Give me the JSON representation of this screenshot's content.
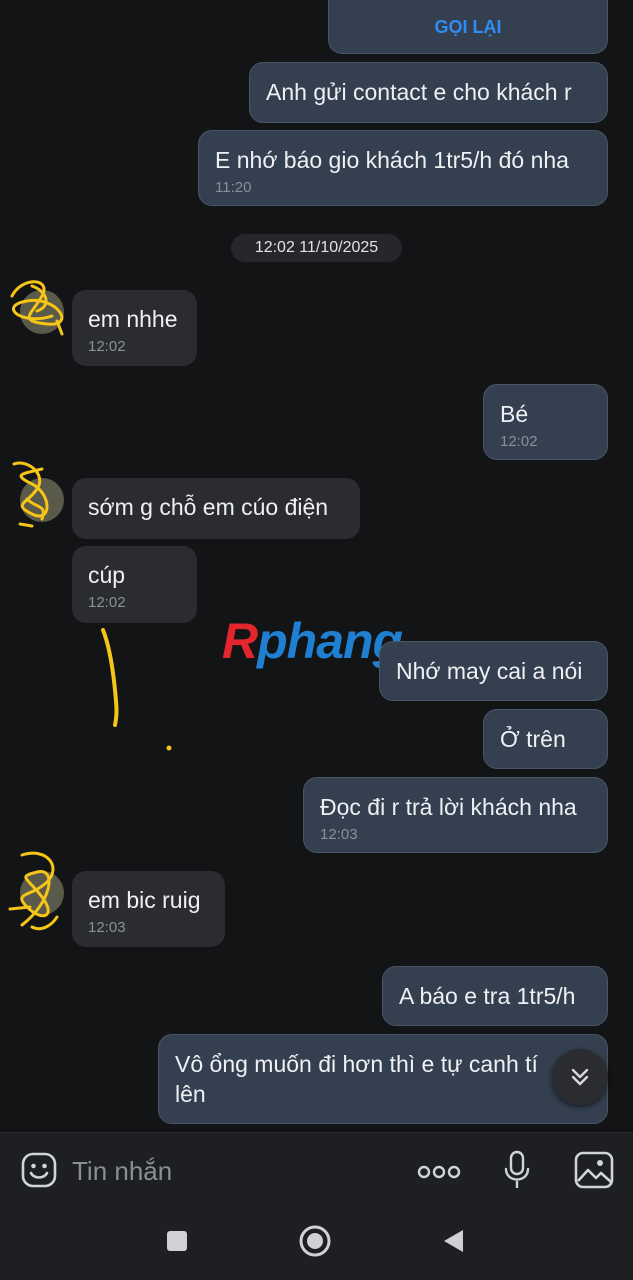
{
  "call_card": {
    "action_label": "GỌI LẠI"
  },
  "messages": [
    {
      "id": "m1",
      "dir": "out",
      "text": "Anh gửi contact e cho khách r"
    },
    {
      "id": "m2",
      "dir": "out",
      "text": "E nhớ báo gio khách 1tr5/h đó nha",
      "time": "11:20"
    },
    {
      "id": "m3",
      "dir": "in",
      "text": "em nhhe",
      "time": "12:02"
    },
    {
      "id": "m4",
      "dir": "out",
      "text": "Bé",
      "time": "12:02"
    },
    {
      "id": "m5",
      "dir": "in",
      "text": "sớm g chỗ em cúo điện"
    },
    {
      "id": "m6",
      "dir": "in",
      "text": "cúp",
      "time": "12:02"
    },
    {
      "id": "m7",
      "dir": "out",
      "text": "Nhớ may cai a nói"
    },
    {
      "id": "m8",
      "dir": "out",
      "text": "Ở trên"
    },
    {
      "id": "m9",
      "dir": "out",
      "text": "Đọc đi r trả lời khách nha",
      "time": "12:03"
    },
    {
      "id": "m10",
      "dir": "in",
      "text": "em bic ruig",
      "time": "12:03"
    },
    {
      "id": "m11",
      "dir": "out",
      "text": "A báo e tra 1tr5/h"
    },
    {
      "id": "m12",
      "dir": "out",
      "text": "Vô ổng muốn đi hơn thì e tự canh tí lên"
    }
  ],
  "date_separator": "12:02 11/10/2025",
  "watermark": {
    "part1": "R",
    "part2": "phang"
  },
  "composer": {
    "placeholder": "Tin nhắn"
  },
  "icons": {
    "emoji": "emoji-icon",
    "more": "more-icon",
    "mic": "microphone-icon",
    "image": "image-icon",
    "scroll": "chevron-down-double-icon",
    "recents": "square-icon",
    "home": "circle-icon",
    "back": "triangle-back-icon"
  },
  "colors": {
    "accent": "#2f8cf5",
    "outgoing_bubble": "#34404f",
    "incoming_bubble": "#2b2c2f",
    "background": "#131416"
  }
}
